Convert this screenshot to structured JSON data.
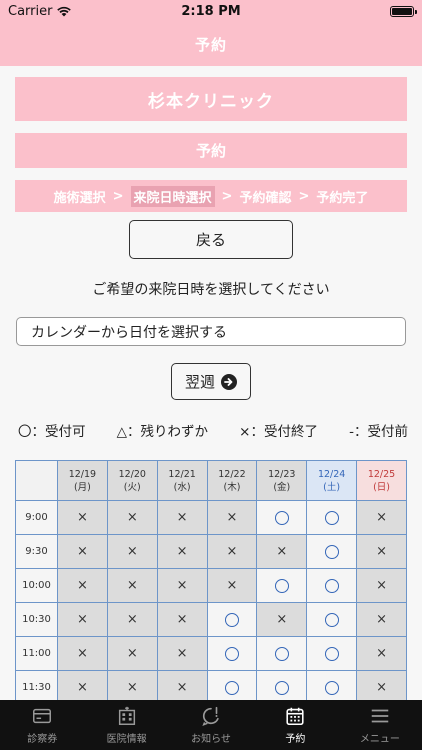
{
  "status_bar": {
    "carrier": "Carrier",
    "time": "2:18 PM"
  },
  "nav": {
    "title": "予約"
  },
  "clinic": {
    "name": "杉本クリニック"
  },
  "section": {
    "label": "予約"
  },
  "steps": {
    "items": [
      "施術選択",
      "来院日時選択",
      "予約確認",
      "予約完了"
    ],
    "separator": ">",
    "active_index": 1
  },
  "back_button": {
    "label": "戻る"
  },
  "instruction": "ご希望の来院日時を選択してください",
  "calendar_input": {
    "value": "カレンダーから日付を選択する"
  },
  "next_week_button": {
    "label": "翌週"
  },
  "legend": {
    "available": "〇：受付可",
    "few": "△：残りわずか",
    "closed": "×：受付終了",
    "before": "-：受付前"
  },
  "schedule": {
    "columns": [
      {
        "date": "12/19",
        "day": "(月)",
        "kind": "weekday"
      },
      {
        "date": "12/20",
        "day": "(火)",
        "kind": "weekday"
      },
      {
        "date": "12/21",
        "day": "(水)",
        "kind": "weekday"
      },
      {
        "date": "12/22",
        "day": "(木)",
        "kind": "weekday"
      },
      {
        "date": "12/23",
        "day": "(金)",
        "kind": "weekday"
      },
      {
        "date": "12/24",
        "day": "(土)",
        "kind": "sat"
      },
      {
        "date": "12/25",
        "day": "(日)",
        "kind": "sun"
      }
    ],
    "rows": [
      {
        "time": "9:00",
        "slots": [
          "x",
          "x",
          "x",
          "x",
          "o",
          "o",
          "x"
        ]
      },
      {
        "time": "9:30",
        "slots": [
          "x",
          "x",
          "x",
          "x",
          "x",
          "o",
          "x"
        ]
      },
      {
        "time": "10:00",
        "slots": [
          "x",
          "x",
          "x",
          "x",
          "o",
          "o",
          "x"
        ]
      },
      {
        "time": "10:30",
        "slots": [
          "x",
          "x",
          "x",
          "o",
          "x",
          "o",
          "x"
        ]
      },
      {
        "time": "11:00",
        "slots": [
          "x",
          "x",
          "x",
          "o",
          "o",
          "o",
          "x"
        ]
      },
      {
        "time": "11:30",
        "slots": [
          "x",
          "x",
          "x",
          "o",
          "o",
          "o",
          "x"
        ]
      }
    ],
    "closed_mark": "×"
  },
  "tab_bar": {
    "items": [
      {
        "label": "診察券",
        "icon": "card-icon"
      },
      {
        "label": "医院情報",
        "icon": "building-icon"
      },
      {
        "label": "お知らせ",
        "icon": "notification-icon"
      },
      {
        "label": "予約",
        "icon": "calendar-icon"
      },
      {
        "label": "メニュー",
        "icon": "menu-icon"
      }
    ],
    "active_index": 3
  }
}
